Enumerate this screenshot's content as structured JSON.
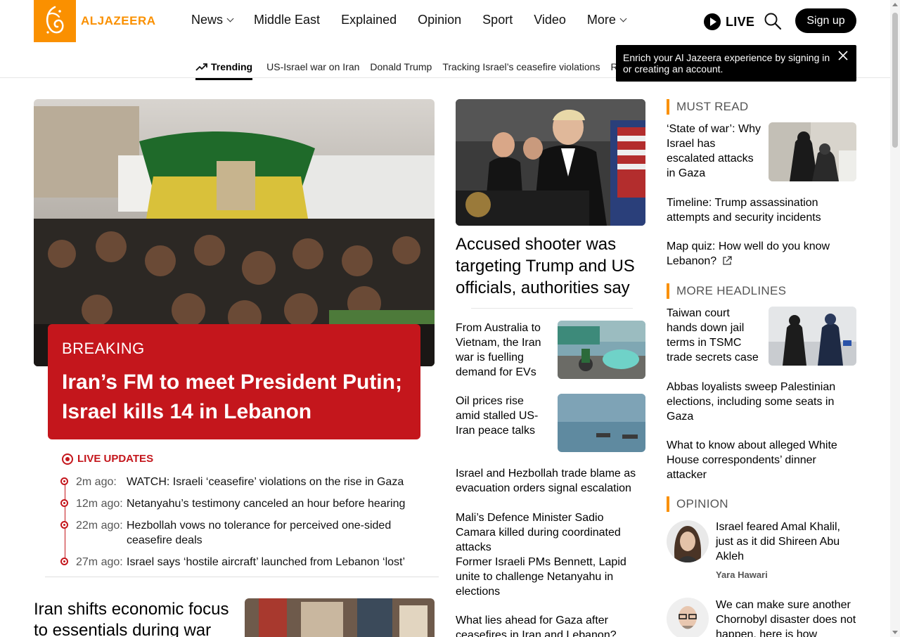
{
  "header": {
    "logo_text": "ALJAZEERA",
    "nav": [
      {
        "label": "News",
        "dropdown": true
      },
      {
        "label": "Middle East",
        "dropdown": false
      },
      {
        "label": "Explained",
        "dropdown": false
      },
      {
        "label": "Opinion",
        "dropdown": false
      },
      {
        "label": "Sport",
        "dropdown": false
      },
      {
        "label": "Video",
        "dropdown": false
      },
      {
        "label": "More",
        "dropdown": true
      }
    ],
    "live_label": "LIVE",
    "signup_label": "Sign up",
    "trending_label": "Trending",
    "trending_links": [
      "US-Israel war on Iran",
      "Donald Trump",
      "Tracking Israel’s ceasefire violations",
      "Ru"
    ],
    "toast_text": "Enrich your Al Jazeera experience by signing in or creating an account."
  },
  "hero": {
    "breaking_label": "BREAKING",
    "breaking_title": "Iran’s FM to meet President Putin; Israel kills 14 in Lebanon",
    "live_updates_label": "LIVE UPDATES",
    "updates": [
      {
        "time": "2m ago:",
        "text": "WATCH: Israeli ‘ceasefire’ violations on the rise in Gaza"
      },
      {
        "time": "12m ago:",
        "text": "Netanyahu’s testimony canceled an hour before hearing"
      },
      {
        "time": "22m ago:",
        "text": "Hezbollah vows no tolerance for perceived one-sided ceasefire deals"
      },
      {
        "time": "27m ago:",
        "text": "Israel says ‘hostile aircraft’ launched from Lebanon ‘lost’"
      }
    ],
    "bottom_story": "Iran shifts economic focus to essentials during war"
  },
  "middle": {
    "lead_title": "Accused shooter was targeting Trump and US officials, authorities say",
    "stories_with_thumbs": [
      "From Australia to Vietnam, the Iran war is fuelling demand for EVs",
      "Oil prices rise amid stalled US-Iran peace talks"
    ],
    "text_stories": [
      "Israel and Hezbollah trade blame as evacuation orders signal escalation",
      "Mali’s Defence Minister Sadio Camara killed during coordinated attacks",
      "Former Israeli PMs Bennett, Lapid unite to challenge Netanyahu in elections",
      "What lies ahead for Gaza after ceasefires in Iran and Lebanon?"
    ]
  },
  "right": {
    "must_read_label": "MUST READ",
    "must_read": [
      "‘State of war’: Why Israel has escalated attacks in Gaza",
      "Timeline: Trump assassination attempts and security incidents",
      "Map quiz: How well do you know Lebanon?"
    ],
    "more_headlines_label": "MORE HEADLINES",
    "more_headlines": [
      "Taiwan court hands down jail terms in TSMC trade secrets case",
      "Abbas loyalists sweep Palestinian elections, including some seats in Gaza",
      "What to know about alleged White House correspondents’ dinner attacker"
    ],
    "opinion_label": "OPINION",
    "opinion": [
      {
        "title": "Israel feared Amal Khalil, just as it did Shireen Abu Akleh",
        "author": "Yara Hawari"
      },
      {
        "title": "We can make sure another Chornobyl disaster does not happen, here is how",
        "author": ""
      }
    ]
  },
  "colors": {
    "brand": "#fa9000",
    "breaking": "#c4161c"
  }
}
